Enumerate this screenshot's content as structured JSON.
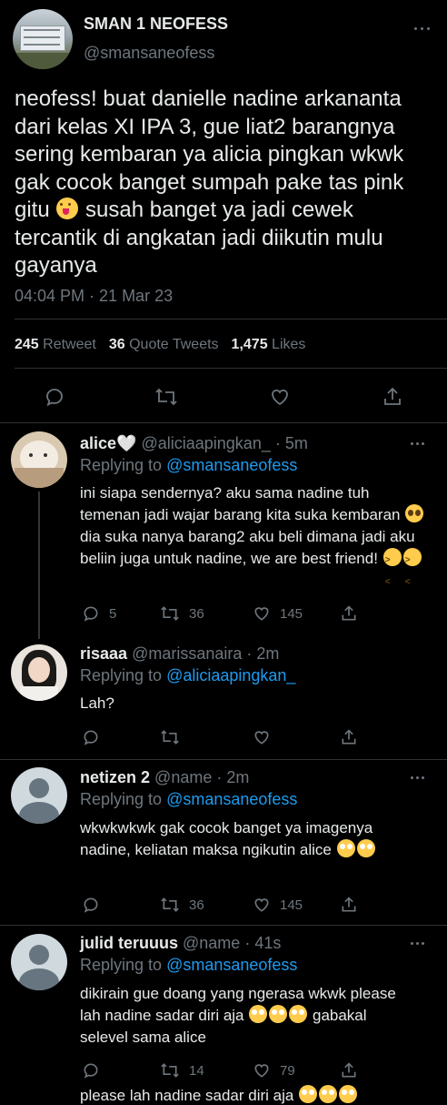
{
  "main_tweet": {
    "display_name": "SMAN 1 NEOFESS",
    "handle": "@smansaneofess",
    "text_part1": "neofess! buat danielle nadine arkananta dari kelas XI IPA 3, gue liat2 barangnya sering kembaran ya alicia pingkan wkwk gak cocok banget sumpah pake tas pink gitu",
    "text_part2": "susah banget ya jadi cewek tercantik di angkatan jadi diikutin mulu gayanya",
    "timestamp": "04:04 PM · 21 Mar 23",
    "stats": {
      "retweets": "245",
      "retweets_label": "Retweet",
      "quotes": "36",
      "quotes_label": "Quote Tweets",
      "likes": "1,475",
      "likes_label": "Likes"
    }
  },
  "replies": [
    {
      "display_name": "alice🤍",
      "handle": "@aliciaapingkan_",
      "time": "5m",
      "replying_label": "Replying to",
      "replying_to": "@smansaneofess",
      "text_part1": "ini siapa sendernya? aku sama nadine tuh temenan jadi wajar barang kita suka kembaran",
      "text_part2": "dia suka nanya barang2 aku beli dimana jadi aku beliin juga untuk nadine, we are best friend!",
      "replies_count": "5",
      "retweets_count": "36",
      "likes_count": "145"
    },
    {
      "display_name": "risaaa",
      "handle": "@marissanaira",
      "time": "2m",
      "replying_label": "Replying to",
      "replying_to": "@aliciaapingkan_",
      "text": "Lah?"
    },
    {
      "display_name": "netizen 2",
      "handle": "@name",
      "time": "2m",
      "replying_label": "Replying to",
      "replying_to": "@smansaneofess",
      "text": "wkwkwkwk gak cocok banget ya imagenya nadine, keliatan maksa ngikutin alice",
      "retweets_count": "36",
      "likes_count": "145"
    },
    {
      "display_name": "julid teruuus",
      "handle": "@name",
      "time": "41s",
      "replying_label": "Replying to",
      "replying_to": "@smansaneofess",
      "text_part1": "dikirain gue doang yang ngerasa wkwk please lah nadine sadar diri aja",
      "text_part2": "gabakal selevel sama alice",
      "retweets_count": "14",
      "likes_count": "79"
    }
  ],
  "cutoff_text": "please lah nadine sadar diri aja",
  "colors": {
    "background": "#000000",
    "link": "#1d9bf0",
    "muted": "#6e767d",
    "separator": "#2f3336"
  }
}
